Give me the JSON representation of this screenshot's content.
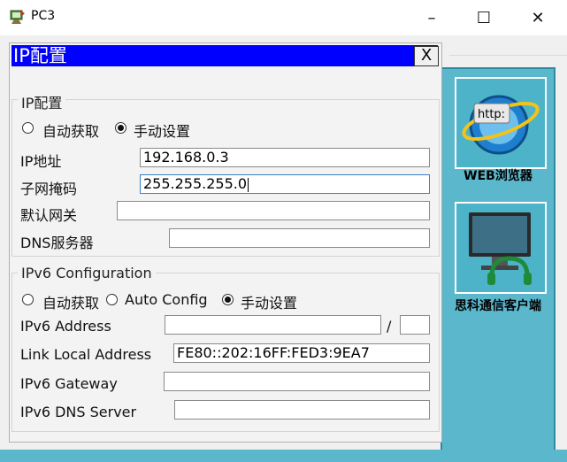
{
  "window": {
    "title": "PC3",
    "app_icon": "packet-tracer-pc-icon",
    "controls": {
      "minimize": "–",
      "maximize": "☐",
      "close": "✕"
    }
  },
  "dialog": {
    "title": "IP配置",
    "close_label": "X",
    "ipv4": {
      "legend": "IP配置",
      "radio_auto": "自动获取",
      "radio_manual": "手动设置",
      "selected": "manual",
      "ip_label": "IP地址",
      "ip_value": "192.168.0.3",
      "mask_label": "子网掩码",
      "mask_value": "255.255.255.0",
      "gateway_label": "默认网关",
      "gateway_value": "",
      "dns_label": "DNS服务器",
      "dns_value": ""
    },
    "ipv6": {
      "legend": "IPv6 Configuration",
      "radio_auto": "自动获取",
      "radio_autoconfig": "Auto Config",
      "radio_manual": "手动设置",
      "selected": "manual",
      "address_label": "IPv6 Address",
      "address_value": "",
      "slash": "/",
      "prefix_value": "",
      "link_local_label": "Link Local Address",
      "link_local_value": "FE80::202:16FF:FED3:9EA7",
      "gateway_label": "IPv6 Gateway",
      "gateway_value": "",
      "dns_label": "IPv6 DNS Server",
      "dns_value": ""
    }
  },
  "desktop": {
    "apps": [
      {
        "label": "WEB浏览器",
        "icon": "web-browser-icon",
        "icon_text": "http:"
      },
      {
        "label": "思科通信客户端",
        "icon": "cisco-ip-communicator-icon"
      }
    ]
  },
  "colors": {
    "dialog_title_bg": "#0000ff",
    "desktop_bg": "#5bb7cc",
    "field_focus": "#3a7fc4"
  }
}
